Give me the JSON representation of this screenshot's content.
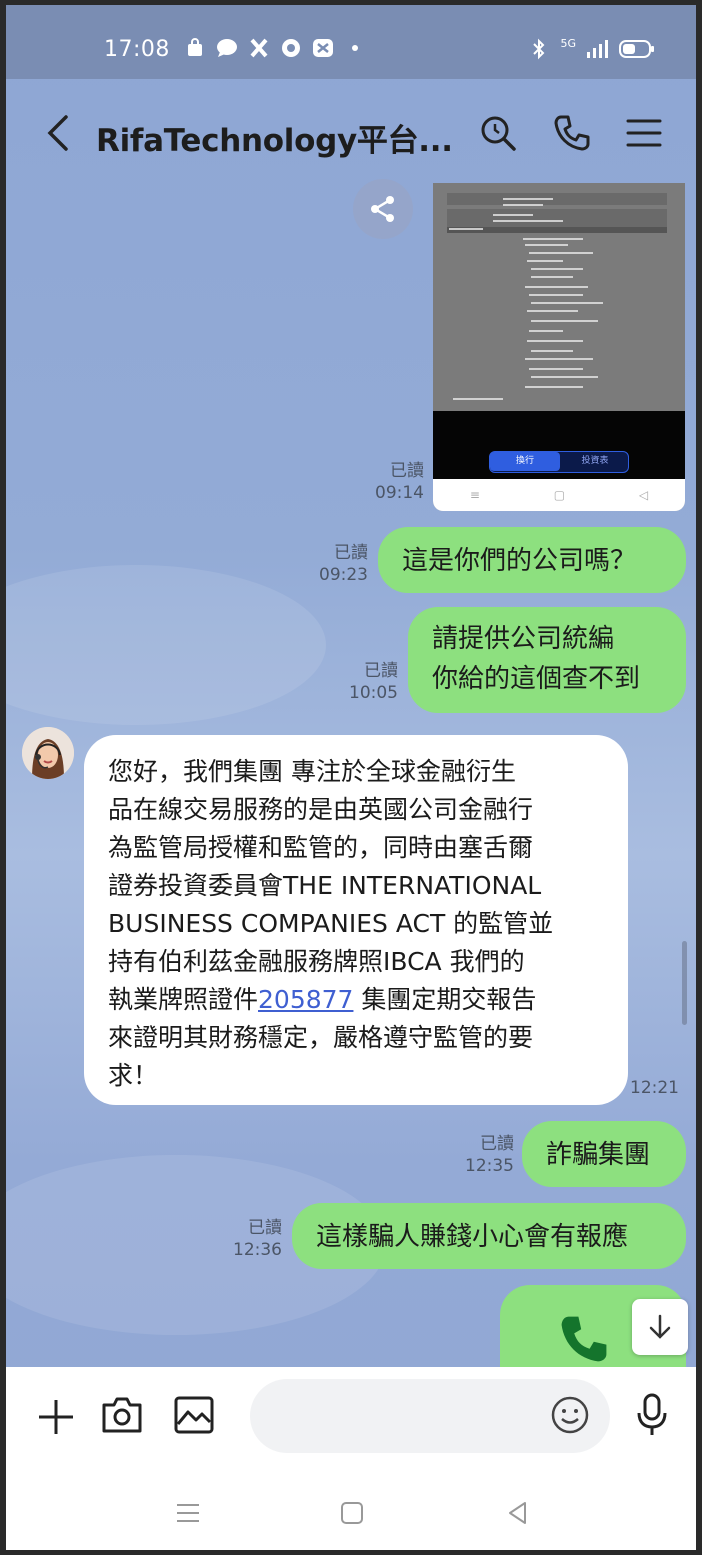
{
  "status_bar": {
    "time": "17:08",
    "network": "5G"
  },
  "header": {
    "title": "RifaTechnology平台..."
  },
  "messages": {
    "m1": {
      "read": "已讀",
      "time": "09:14"
    },
    "m1_screenshot": {
      "btn_left": "換行",
      "btn_right": "投資表"
    },
    "m2": {
      "read": "已讀",
      "time": "09:23",
      "text": "這是你們的公司嗎？"
    },
    "m3": {
      "read": "已讀",
      "time": "10:05",
      "line1": "請提供公司統編",
      "line2": "你給的這個查不到"
    },
    "m4": {
      "time": "12:21",
      "lines": [
        "您好，我們集團 專注於全球金融衍生",
        "品在線交易服務的是由英國公司金融行",
        "為監管局授權和監管的，同時由塞舌爾",
        "證券投資委員會THE INTERNATIONAL",
        "BUSINESS COMPANIES ACT 的監管並",
        "持有伯利茲金融服務牌照IBCA 我們的"
      ],
      "line7_pre": "執業牌照證件",
      "line7_link": "205877",
      "line7_post": " 集團定期交報告",
      "line8": "來證明其財務穩定，嚴格遵守監管的要",
      "line9": "求！"
    },
    "m5": {
      "read": "已讀",
      "time": "12:35",
      "text": "詐騙集團"
    },
    "m6": {
      "read": "已讀",
      "time": "12:36",
      "text": "這樣騙人賺錢小心會有報應"
    }
  },
  "input": {
    "placeholder": ""
  },
  "colors": {
    "outgoing_bubble": "#8de07f",
    "incoming_bubble": "#ffffff",
    "chat_background": "#8fa7d3",
    "link": "#3f5fd1"
  }
}
